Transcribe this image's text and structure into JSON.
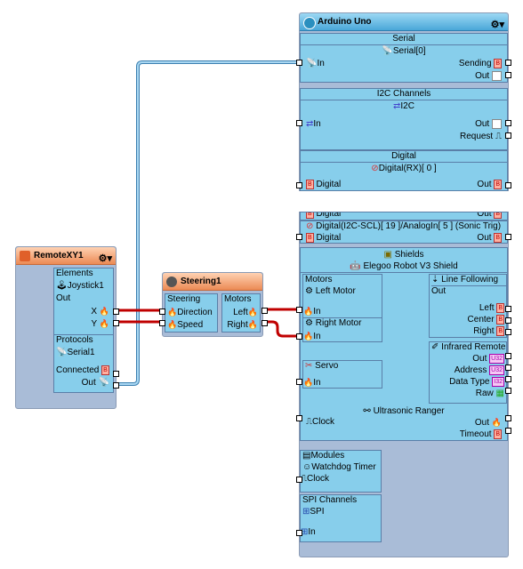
{
  "remote": {
    "title": "RemoteXY1",
    "elements_label": "Elements",
    "joystick": "Joystick1",
    "out_label": "Out",
    "x": "X",
    "y": "Y",
    "protocols_label": "Protocols",
    "serial": "Serial1",
    "connected": "Connected",
    "out2": "Out"
  },
  "steering": {
    "title": "Steering1",
    "steering_label": "Steering",
    "direction": "Direction",
    "speed": "Speed",
    "motors_label": "Motors",
    "left": "Left",
    "right": "Right"
  },
  "arduino": {
    "title": "Arduino Uno",
    "serial_header": "Serial",
    "serial0": "Serial[0]",
    "in": "In",
    "sending": "Sending",
    "out": "Out",
    "i2c_header": "I2C Channels",
    "i2c": "I2C",
    "i2c_in": "In",
    "i2c_out": "Out",
    "request": "Request",
    "digital_header": "Digital",
    "digital_rx": "Digital(RX)[ 0 ]",
    "digital_in": "Digital",
    "digital_out": "Out",
    "digital_top_in": "Digital",
    "digital_top_out": "Out",
    "digital_scl": "Digital(I2C-SCL)[ 19 ]/AnalogIn[ 5 ] (Sonic Trig)",
    "digital_scl_in": "Digital",
    "digital_scl_out": "Out",
    "shields": "Shields",
    "shield_name": "Elegoo Robot V3 Shield",
    "motors_label": "Motors",
    "left_motor": "Left Motor",
    "left_motor_in": "In",
    "right_motor": "Right Motor",
    "right_motor_in": "In",
    "servo": "Servo",
    "servo_in": "In",
    "line_following": "Line Following",
    "lf_out": "Out",
    "lf_left": "Left",
    "lf_center": "Center",
    "lf_right": "Right",
    "infrared": "Infrared Remote",
    "ir_out": "Out",
    "ir_address": "Address",
    "ir_datatype": "Data Type",
    "ir_raw": "Raw",
    "ultrasonic": "Ultrasonic Ranger",
    "clock": "Clock",
    "us_out": "Out",
    "timeout": "Timeout",
    "modules": "Modules",
    "watchdog": "Watchdog Timer",
    "wd_clock": "Clock",
    "spi_channels": "SPI Channels",
    "spi": "SPI",
    "spi_in": "In",
    "badge_b": "B",
    "badge_u32": "U32",
    "badge_i32": "I32"
  },
  "colors": {
    "wire_red": "#c00000",
    "wire_blue": "#5fa8d8",
    "panel": "#87ceeb"
  },
  "icons": [
    "settings-tools-icon",
    "joystick-icon",
    "serial-icon",
    "steering-icon",
    "motor-icon",
    "servo-icon",
    "shield-icon",
    "sensor-icon",
    "clock-icon",
    "watchdog-icon",
    "i2c-icon",
    "spi-icon",
    "digital-icon"
  ]
}
